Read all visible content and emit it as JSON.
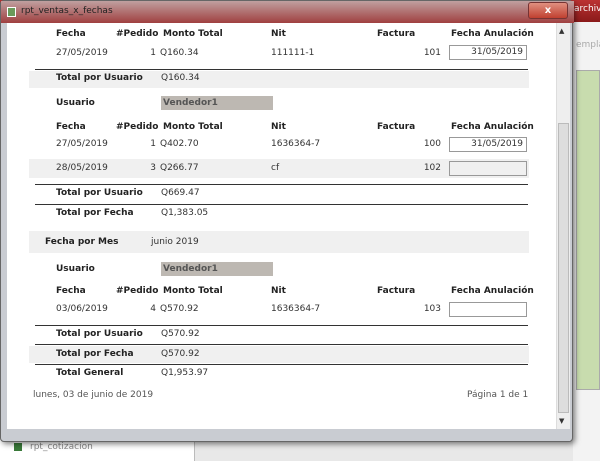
{
  "window": {
    "title": "rpt_ventas_x_fechas",
    "close": "x"
  },
  "background": {
    "menu": "archivo",
    "field": "emplaz",
    "list_item": "rpt_cotizacion"
  },
  "columns": {
    "fecha": "Fecha",
    "pedido": "#Pedido",
    "monto": "Monto Total",
    "nit": "Nit",
    "factura": "Factura",
    "anulacion": "Fecha Anulación"
  },
  "labels": {
    "total_usuario": "Total por Usuario",
    "usuario": "Usuario",
    "total_fecha": "Total por Fecha",
    "fecha_mes": "Fecha por Mes",
    "total_general": "Total General"
  },
  "group1": {
    "rows": [
      {
        "fecha": "27/05/2019",
        "pedido": "1",
        "monto": "Q160.34",
        "nit": "111111-1",
        "factura": "101",
        "anulacion": "31/05/2019"
      }
    ],
    "total_usuario": "Q160.34"
  },
  "group2": {
    "usuario": "Vendedor1",
    "rows": [
      {
        "fecha": "27/05/2019",
        "pedido": "1",
        "monto": "Q402.70",
        "nit": "1636364-7",
        "factura": "100",
        "anulacion": "31/05/2019"
      },
      {
        "fecha": "28/05/2019",
        "pedido": "3",
        "monto": "Q266.77",
        "nit": "cf",
        "factura": "102",
        "anulacion": ""
      }
    ],
    "total_usuario": "Q669.47",
    "total_fecha": "Q1,383.05"
  },
  "month2": {
    "mes": "junio 2019",
    "usuario": "Vendedor1",
    "rows": [
      {
        "fecha": "03/06/2019",
        "pedido": "4",
        "monto": "Q570.92",
        "nit": "1636364-7",
        "factura": "103",
        "anulacion": ""
      }
    ],
    "total_usuario": "Q570.92",
    "total_fecha": "Q570.92"
  },
  "total_general": "Q1,953.97",
  "footer": {
    "date": "lunes, 03 de junio de 2019",
    "page": "Página 1 de 1"
  }
}
